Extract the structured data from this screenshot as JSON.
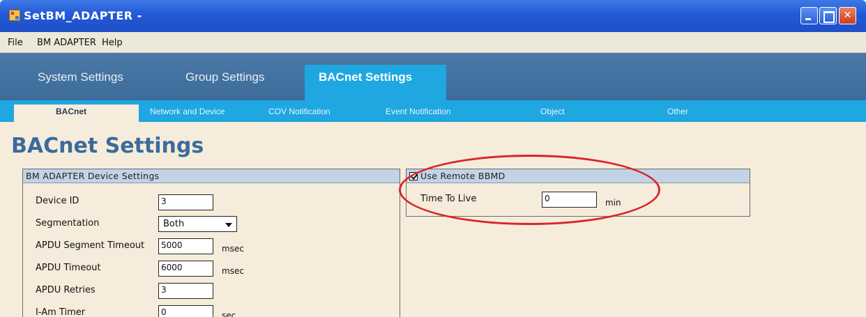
{
  "window": {
    "title": "SetBM_ADAPTER -"
  },
  "menu": {
    "items": [
      "File",
      "BM ADAPTER",
      "Help"
    ]
  },
  "main_tabs": {
    "items": [
      "System Settings",
      "Group Settings",
      "BACnet Settings"
    ],
    "active": "BACnet Settings"
  },
  "sub_tabs": {
    "items": [
      "BACnet",
      "Network and Device",
      "COV Notification",
      "Event Notification",
      "Object",
      "Other"
    ],
    "active": "BACnet"
  },
  "page": {
    "title": "BACnet Settings"
  },
  "device_settings": {
    "header": "BM ADAPTER Device Settings",
    "device_id_label": "Device ID",
    "device_id_value": "3",
    "segmentation_label": "Segmentation",
    "segmentation_value": "Both",
    "apdu_segment_timeout_label": "APDU Segment Timeout",
    "apdu_segment_timeout_value": "5000",
    "apdu_segment_timeout_unit": "msec",
    "apdu_timeout_label": "APDU Timeout",
    "apdu_timeout_value": "6000",
    "apdu_timeout_unit": "msec",
    "apdu_retries_label": "APDU Retries",
    "apdu_retries_value": "3",
    "i_am_timer_label": "I-Am Timer",
    "i_am_timer_value": "0",
    "i_am_timer_unit": "sec"
  },
  "bbmd": {
    "header": "Use Remote BBMD",
    "checked": true,
    "time_to_live_label": "Time To Live",
    "time_to_live_value": "0",
    "time_to_live_unit": "min"
  },
  "colors": {
    "titlebar": "#2358d6",
    "tabbar": "#4a79a6",
    "active_tab": "#1ea7e1",
    "content_bg": "#f6ecdb",
    "group_header": "#c2d3e6",
    "page_title": "#3a6b9c",
    "annotation": "#d9252a"
  }
}
